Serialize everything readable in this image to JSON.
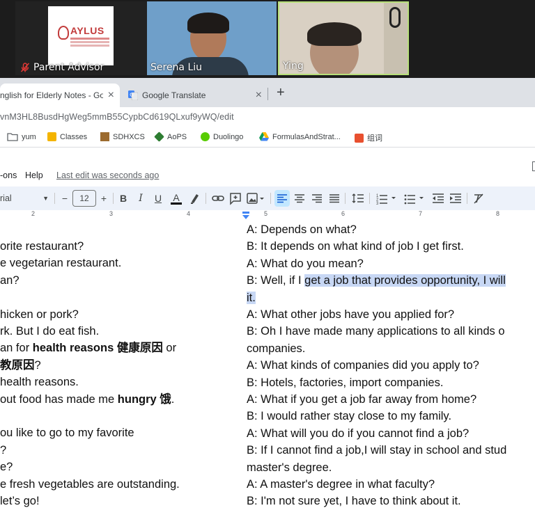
{
  "meeting": {
    "participants": [
      {
        "name": "Parent Advisor",
        "muted": true,
        "logo_text": "AYLUS"
      },
      {
        "name": "Serena Liu"
      },
      {
        "name": "Ying"
      }
    ]
  },
  "browser": {
    "tabs": [
      {
        "title": "nglish for Elderly Notes - Goo",
        "active": true
      },
      {
        "title": "Google Translate",
        "active": false
      }
    ],
    "new_tab": "+",
    "close": "×",
    "url": "vnM3HL8BusdHgWeg5mmB55CypbCd619QLxuf9yWQ/edit",
    "bookmarks": [
      {
        "label": "yum",
        "icon": "folder-icon"
      },
      {
        "label": "Classes",
        "icon": "classes-icon"
      },
      {
        "label": "SDHXCS",
        "icon": "sdhxcs-icon"
      },
      {
        "label": "AoPS",
        "icon": "aops-icon"
      },
      {
        "label": "Duolingo",
        "icon": "duolingo-icon"
      },
      {
        "label": "FormulasAndStrat...",
        "icon": "drive-icon"
      },
      {
        "label": "组词",
        "icon": "zuci-icon"
      }
    ]
  },
  "docs": {
    "menu": [
      {
        "label": "-ons"
      },
      {
        "label": "Help"
      }
    ],
    "last_edit": "Last edit was seconds ago",
    "toolbar": {
      "font": "rial",
      "minus": "−",
      "font_size": "12",
      "plus": "+",
      "bold": "B",
      "italic": "I",
      "underline": "U",
      "text_color": "A"
    },
    "ruler_numbers": [
      "2",
      "3",
      "4",
      "5",
      "6",
      "7",
      "8"
    ]
  },
  "left_column": [
    "orite restaurant?",
    "e vegetarian restaurant.",
    "an?",
    "",
    "hicken or pork?",
    "rk. But I do eat fish.",
    {
      "parts": [
        {
          "t": "an for "
        },
        {
          "t": "health reasons",
          "b": true
        },
        {
          "t": " "
        },
        {
          "t": "健康原因",
          "b": true
        },
        {
          "t": " or"
        }
      ]
    },
    {
      "parts": [
        {
          "t": "教原因",
          "b": true
        },
        {
          "t": "?"
        }
      ]
    },
    "health reasons.",
    {
      "parts": [
        {
          "t": "out food has made me "
        },
        {
          "t": "hungry",
          "b": true
        },
        {
          "t": " "
        },
        {
          "t": "饿",
          "b": true
        },
        {
          "t": "."
        }
      ]
    },
    "",
    "ou like to go to my favorite",
    "?",
    "e?",
    "e fresh vegetables are outstanding.",
    "let’s go!"
  ],
  "right_column": [
    "A: Depends on what?",
    "B: It depends on what kind of job I get first.",
    "A: What do you mean?",
    {
      "parts": [
        {
          "t": "B: Well, if I "
        },
        {
          "t": "get a job that provides opportunity, I will",
          "hl": true
        }
      ]
    },
    {
      "parts": [
        {
          "t": "it.",
          "hl": true
        }
      ]
    },
    "A: What other jobs have you applied for?",
    "B: Oh I have made many applications to all kinds o",
    "companies.",
    "A: What kinds of companies did you apply to?",
    "B: Hotels, factories, import companies.",
    "A: What if you get a job far away from home?",
    "B: I would rather stay close to my family.",
    "A: What will you do if you cannot find a job?",
    "B: If I cannot find a job,I will stay in school and stud",
    "master's degree.",
    "A: A master's degree in what faculty?",
    "B: I'm not sure yet, I have to think about it."
  ]
}
